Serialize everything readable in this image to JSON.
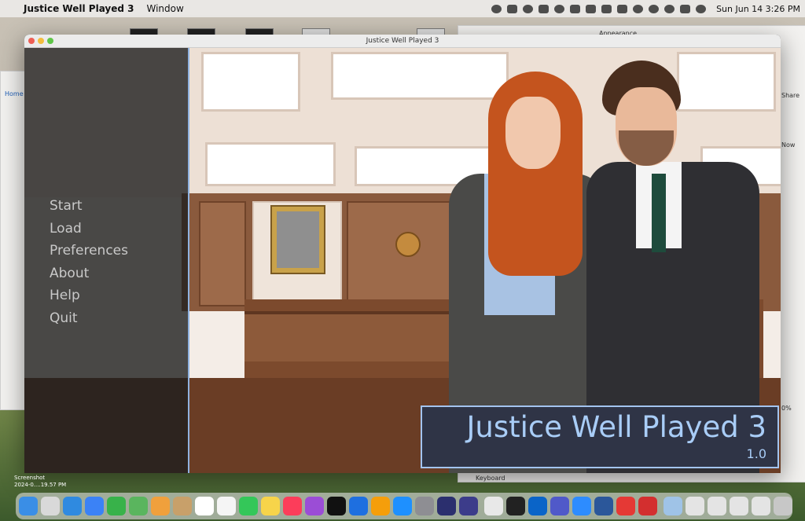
{
  "menubar": {
    "app_name": "Justice Well Played 3",
    "menus": [
      "Window"
    ],
    "clock": "Sun Jun 14  3:26 PM"
  },
  "window": {
    "title": "Justice Well Played 3"
  },
  "main_menu": {
    "items": [
      "Start",
      "Load",
      "Preferences",
      "About",
      "Help",
      "Quit"
    ]
  },
  "game": {
    "title": "Justice Well Played 3",
    "version": "1.0"
  },
  "desktop": {
    "screenshot_label_1": "Screenshot",
    "screenshot_label_2": "2024-0....19.57 PM",
    "bg_window_label": "Appearance",
    "bg_keyboard": "Keyboard",
    "bg_share": "Share",
    "bg_now": "Now",
    "bg_home": "Home",
    "bg_percent": "0%"
  },
  "colors": {
    "accent": "#a9cdf7",
    "title_box": "#2f3446",
    "menu_text": "#c9c9c9"
  },
  "dock": {
    "icons": [
      "finder-icon",
      "launchpad-icon",
      "safari-icon",
      "mail-icon",
      "facetime-icon",
      "maps-icon",
      "photos-icon",
      "contacts-icon",
      "calendar-icon",
      "reminders-icon",
      "messages-icon",
      "notes-icon",
      "music-icon",
      "podcasts-icon",
      "tv-icon",
      "keynote-icon",
      "pages-icon",
      "app-store-icon",
      "settings-icon",
      "utility-icon",
      "utility-icon-2",
      "chrome-icon",
      "terminal-icon",
      "outlook-icon",
      "teams-icon",
      "zoom-icon",
      "word-icon",
      "tasks-icon",
      "acrobat-icon",
      "finder-alt-icon",
      "folder-icon",
      "folder-icon-2",
      "folder-icon-3",
      "folder-icon-4",
      "trash-icon"
    ]
  }
}
